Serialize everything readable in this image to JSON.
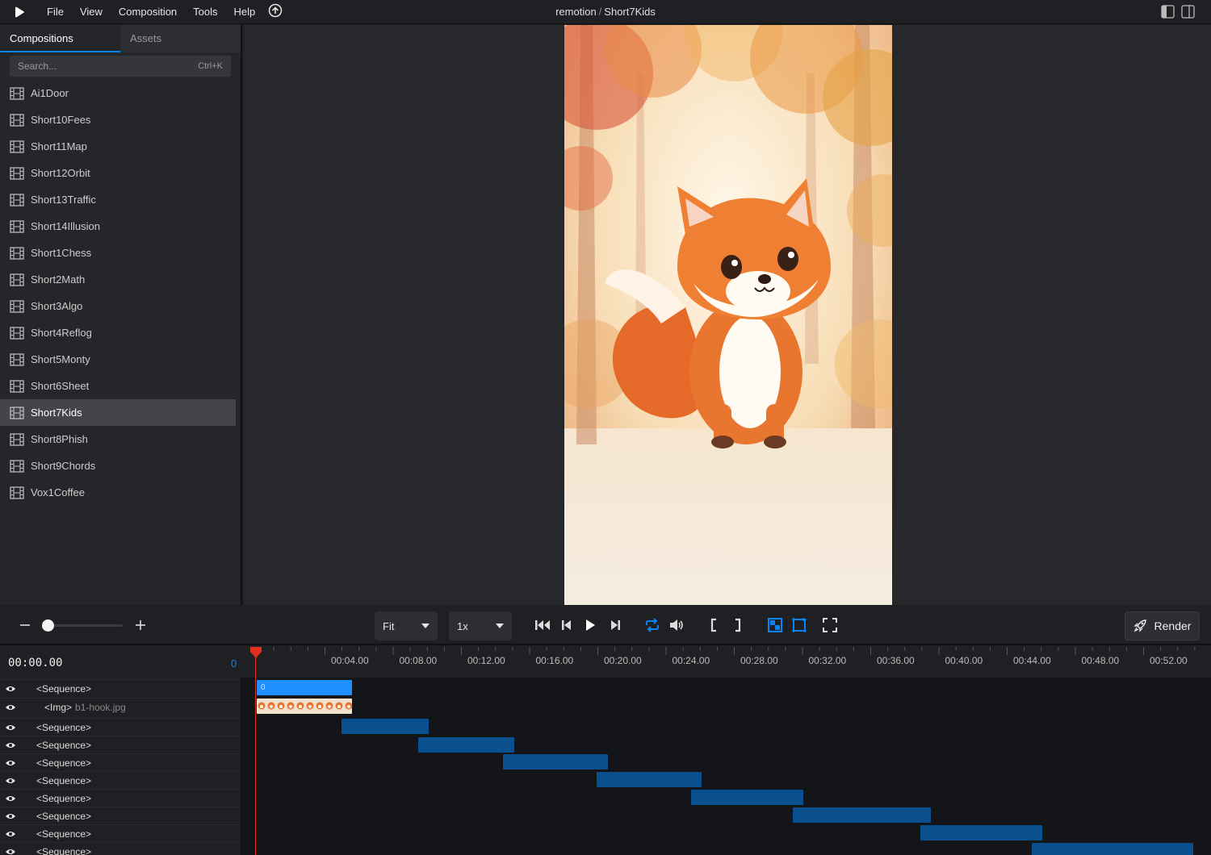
{
  "menubar": {
    "items": [
      "File",
      "View",
      "Composition",
      "Tools",
      "Help"
    ],
    "title_project": "remotion",
    "title_separator": "/",
    "title_comp": "Short7Kids"
  },
  "sidebar": {
    "tabs": [
      "Compositions",
      "Assets"
    ],
    "active_tab": "Compositions",
    "search_placeholder": "Search...",
    "search_shortcut": "Ctrl+K",
    "compositions": [
      "Ai1Door",
      "Short10Fees",
      "Short11Map",
      "Short12Orbit",
      "Short13Traffic",
      "Short14Illusion",
      "Short1Chess",
      "Short2Math",
      "Short3Algo",
      "Short4Reflog",
      "Short5Monty",
      "Short6Sheet",
      "Short7Kids",
      "Short8Phish",
      "Short9Chords",
      "Vox1Coffee"
    ],
    "selected": "Short7Kids"
  },
  "controls": {
    "size_select": "Fit",
    "speed_select": "1x",
    "render_label": "Render",
    "accent_color": "#0b84f3"
  },
  "timeline": {
    "timecode": "00:00.00",
    "frame": "0",
    "ruler_labels": [
      "00:04.00",
      "00:08.00",
      "00:12.00",
      "00:16.00",
      "00:20.00",
      "00:24.00",
      "00:28.00",
      "00:32.00",
      "00:36.00",
      "00:40.00",
      "00:44.00",
      "00:48.00",
      "00:52.00"
    ],
    "tracks": [
      {
        "name": "<Sequence>",
        "file": ""
      },
      {
        "name": "<Img>",
        "file": "b1-hook.jpg"
      },
      {
        "name": "<Sequence>",
        "file": ""
      },
      {
        "name": "<Sequence>",
        "file": ""
      },
      {
        "name": "<Sequence>",
        "file": ""
      },
      {
        "name": "<Sequence>",
        "file": ""
      },
      {
        "name": "<Sequence>",
        "file": ""
      },
      {
        "name": "<Sequence>",
        "file": ""
      },
      {
        "name": "<Sequence>",
        "file": ""
      },
      {
        "name": "<Sequence>",
        "file": ""
      }
    ],
    "selected_clip_label": "0",
    "playhead_color": "#e0301e"
  }
}
